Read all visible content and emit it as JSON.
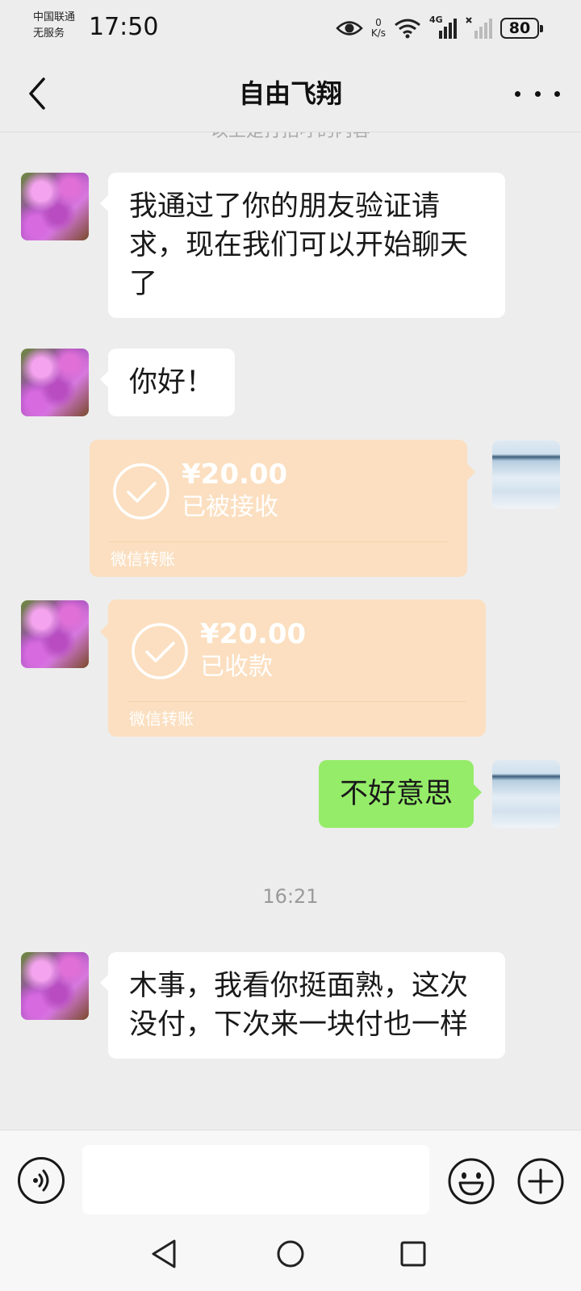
{
  "status_bar": {
    "carrier_line1": "中国联通",
    "carrier_line2": "无服务",
    "time": "17:50",
    "net_speed_value": "0",
    "net_speed_unit": "K/s",
    "signal_label": "4G",
    "battery": "80"
  },
  "header": {
    "title": "自由飞翔"
  },
  "system_message": "以上是打招呼的内容",
  "messages": [
    {
      "side": "left",
      "type": "text",
      "text": "我通过了你的朋友验证请求，现在我们可以开始聊天了"
    },
    {
      "side": "left",
      "type": "text",
      "text": "你好！"
    },
    {
      "side": "right",
      "type": "transfer",
      "amount": "¥20.00",
      "status": "已被接收",
      "label": "微信转账"
    },
    {
      "side": "left",
      "type": "transfer",
      "amount": "¥20.00",
      "status": "已收款",
      "label": "微信转账"
    },
    {
      "side": "right",
      "type": "text",
      "text": "不好意思"
    },
    {
      "side": "left",
      "type": "text",
      "text": "木事，我看你挺面熟，这次没付，下次来一块付也一样"
    }
  ],
  "timestamp": "16:21",
  "input": {
    "value": "",
    "placeholder": ""
  },
  "colors": {
    "background": "#ededed",
    "sent_bubble": "#95ec69",
    "received_bubble": "#ffffff",
    "transfer_bubble": "#fbdfc0"
  },
  "icons": {
    "back": "back-chevron-icon",
    "more": "more-dots-icon",
    "voice": "voice-icon",
    "emoji": "emoji-icon",
    "plus": "plus-icon",
    "check": "check-circle-icon",
    "nav_back": "triangle-back-icon",
    "nav_home": "circle-home-icon",
    "nav_recent": "square-recent-icon"
  }
}
